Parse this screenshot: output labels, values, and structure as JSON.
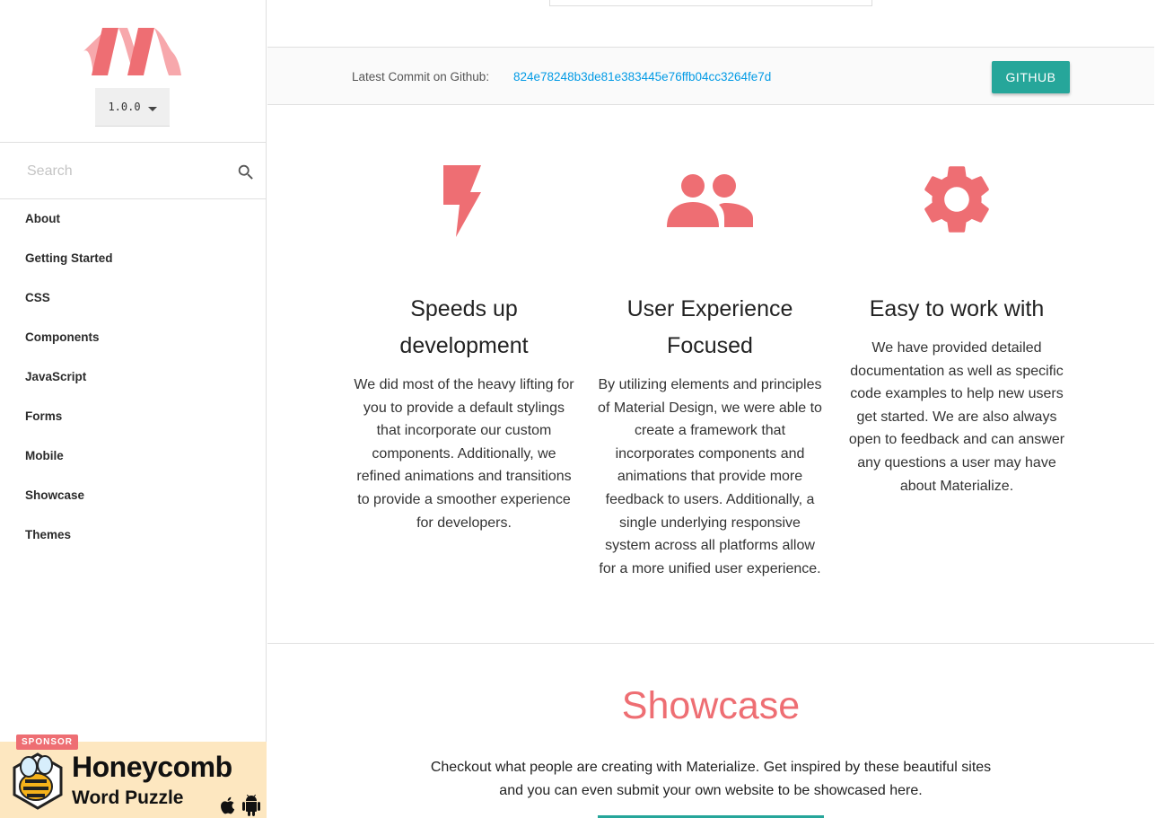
{
  "sidebar": {
    "version": "1.0.0",
    "search": {
      "placeholder": "Search"
    },
    "items": [
      {
        "label": "About"
      },
      {
        "label": "Getting Started"
      },
      {
        "label": "CSS"
      },
      {
        "label": "Components"
      },
      {
        "label": "JavaScript"
      },
      {
        "label": "Forms"
      },
      {
        "label": "Mobile"
      },
      {
        "label": "Showcase"
      },
      {
        "label": "Themes"
      }
    ],
    "sponsor": {
      "badge": "SPONSOR",
      "title": "Honeycomb",
      "subtitle": "Word Puzzle"
    }
  },
  "commit": {
    "label": "Latest Commit on Github:",
    "hash": "824e78248b3de81e383445e76ffb04cc3264fe7d",
    "button": "GITHUB"
  },
  "features": [
    {
      "icon": "flash-icon",
      "title": "Speeds up development",
      "text": "We did most of the heavy lifting for you to provide a default stylings that incorporate our custom components. Additionally, we refined animations and transitions to provide a smoother experience for developers."
    },
    {
      "icon": "group-icon",
      "title": "User Experience Focused",
      "text": "By utilizing elements and principles of Material Design, we were able to create a framework that incorporates components and animations that provide more feedback to users. Additionally, a single underlying responsive system across all platforms allow for a more unified user experience."
    },
    {
      "icon": "settings-icon",
      "title": "Easy to work with",
      "text": "We have provided detailed documentation as well as specific code examples to help new users get started. We are also always open to feedback and can answer any questions a user may have about Materialize."
    }
  ],
  "showcase": {
    "title": "Showcase",
    "text": "Checkout what people are creating with Materialize. Get inspired by these beautiful sites and you can even submit your own website to be showcased here."
  },
  "colors": {
    "accent": "#ee6e73",
    "teal": "#26a69a",
    "link": "#039be5"
  }
}
